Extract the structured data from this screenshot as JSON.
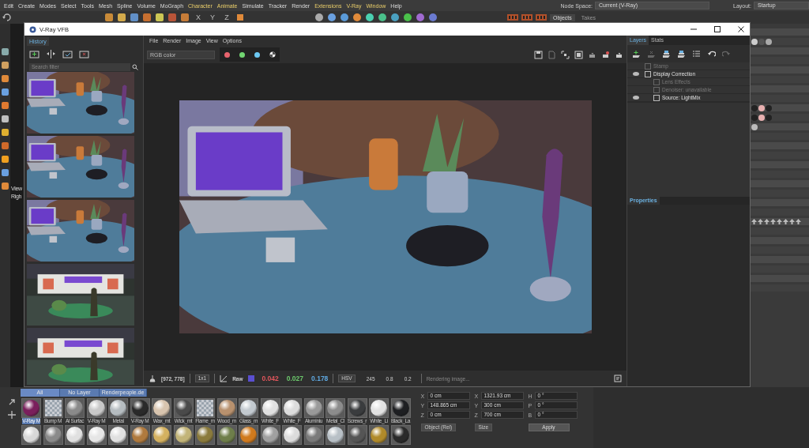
{
  "app_menu": [
    {
      "label": "Edit",
      "highlighted": false
    },
    {
      "label": "Create",
      "highlighted": false
    },
    {
      "label": "Modes",
      "highlighted": false
    },
    {
      "label": "Select",
      "highlighted": false
    },
    {
      "label": "Tools",
      "highlighted": false
    },
    {
      "label": "Mesh",
      "highlighted": false
    },
    {
      "label": "Spline",
      "highlighted": false
    },
    {
      "label": "Volume",
      "highlighted": false
    },
    {
      "label": "MoGraph",
      "highlighted": false
    },
    {
      "label": "Character",
      "highlighted": true
    },
    {
      "label": "Animate",
      "highlighted": true
    },
    {
      "label": "Simulate",
      "highlighted": false
    },
    {
      "label": "Tracker",
      "highlighted": false
    },
    {
      "label": "Render",
      "highlighted": false
    },
    {
      "label": "Extensions",
      "highlighted": true
    },
    {
      "label": "V-Ray",
      "highlighted": true
    },
    {
      "label": "Window",
      "highlighted": true
    },
    {
      "label": "Help",
      "highlighted": false
    }
  ],
  "node_space": {
    "label": "Node Space:",
    "value": "Current (V-Ray)"
  },
  "layout": {
    "label": "Layout:",
    "value": "Startup"
  },
  "toolbar": {
    "axis_buttons": [
      "X",
      "Y",
      "Z"
    ],
    "tabs": [
      {
        "label": "Objects",
        "selected": true
      },
      {
        "label": "Takes",
        "selected": false
      }
    ]
  },
  "viewport_labels": [
    "View",
    "Righ"
  ],
  "vfb": {
    "title": "V-Ray VFB",
    "history": {
      "tab": "History",
      "search": {
        "placeholder": "Search filter"
      }
    },
    "menu": [
      "File",
      "Render",
      "Image",
      "View",
      "Options"
    ],
    "channel_select": {
      "value": "RGB color"
    },
    "channels": [
      {
        "color": "#e8636d"
      },
      {
        "color": "#72d672"
      },
      {
        "color": "#6cc8f2"
      }
    ],
    "layers_panel": {
      "tabs": [
        {
          "label": "Layers",
          "selected": true
        },
        {
          "label": "Stats",
          "selected": false
        }
      ],
      "layers": [
        {
          "name": "Stamp",
          "visible": false,
          "disabled": true
        },
        {
          "name": "Display Correction",
          "visible": true,
          "disabled": false,
          "children": [
            {
              "name": "Lens Effects",
              "visible": false,
              "disabled": true
            },
            {
              "name": "Denoiser: unavailable",
              "visible": false,
              "disabled": true
            },
            {
              "name": "Source: LightMix",
              "visible": true,
              "disabled": false
            }
          ]
        }
      ],
      "properties": "Properties"
    },
    "status": {
      "coords": "[972, 778]",
      "zoom": "1x1",
      "mode": "Raw",
      "values": [
        {
          "text": "0.042",
          "color": "#e0565c"
        },
        {
          "text": "0.027",
          "color": "#6cc86c"
        },
        {
          "text": "0.178",
          "color": "#5fa8e0"
        }
      ],
      "color_space": "HSV",
      "hsv": [
        "245",
        "0.8",
        "0.2"
      ],
      "message": "Rendering image..."
    }
  },
  "materials": {
    "filters": [
      {
        "label": "All",
        "selected": true
      },
      {
        "label": "No Layer",
        "selected": false
      },
      {
        "label": "Renderpeople.de",
        "selected": false
      }
    ],
    "row_1": [
      {
        "label": "V-Ray M",
        "kind": "sphere",
        "color": "#7a1f5c",
        "selected": true
      },
      {
        "label": "Bump M",
        "kind": "checker",
        "color": "#9aa4ae",
        "selected": false
      },
      {
        "label": "Al Surfac",
        "kind": "sphere",
        "color": "#8a8a8a",
        "selected": false
      },
      {
        "label": "V-Ray M",
        "kind": "sphere",
        "color": "#c8c8c8",
        "selected": false
      },
      {
        "label": "Metal",
        "kind": "sphere",
        "color": "#b5bcc0",
        "selected": false
      },
      {
        "label": "V-Ray M",
        "kind": "sphere",
        "color": "#2a2a2a",
        "selected": false
      },
      {
        "label": "Wax_mt",
        "kind": "sphere",
        "color": "#d8c4ae",
        "selected": false
      },
      {
        "label": "Wick_mt",
        "kind": "sphere",
        "color": "#4a4a4a",
        "selected": false
      },
      {
        "label": "Flame_m",
        "kind": "checker",
        "color": "#9aa4ae",
        "selected": false
      },
      {
        "label": "Wood_m",
        "kind": "sphere",
        "color": "#b8916e",
        "selected": false
      },
      {
        "label": "Glass_m",
        "kind": "sphere",
        "color": "#c2c9cf",
        "selected": false
      },
      {
        "label": "White_F",
        "kind": "sphere",
        "color": "#e0e0e0",
        "selected": false
      },
      {
        "label": "White_F",
        "kind": "sphere",
        "color": "#dcdcdc",
        "selected": false
      },
      {
        "label": "Aluminiu",
        "kind": "sphere",
        "color": "#9a9a9a",
        "selected": false
      },
      {
        "label": "Metal_Cl",
        "kind": "sphere",
        "color": "#8c8c8c",
        "selected": false
      },
      {
        "label": "Screws_r",
        "kind": "sphere",
        "color": "#3a3c3e",
        "selected": false
      },
      {
        "label": "White_Li",
        "kind": "sphere",
        "color": "#e2e2e2",
        "selected": false
      },
      {
        "label": "Black_La",
        "kind": "sphere",
        "color": "#1e1f22",
        "selected": false
      }
    ],
    "row_2": [
      {
        "color": "#d8d8d8"
      },
      {
        "color": "#8a8a8a"
      },
      {
        "color": "#e0e0e0"
      },
      {
        "color": "#e6e6e6"
      },
      {
        "color": "#e0e0e0"
      },
      {
        "color": "#b07a3e"
      },
      {
        "color": "#d4b160"
      },
      {
        "color": "#c2b478"
      },
      {
        "color": "#8a7a3c"
      },
      {
        "color": "#6e7e4a"
      },
      {
        "color": "#d07a1e"
      },
      {
        "color": "#a0a0a0"
      },
      {
        "color": "#dcdcdc"
      },
      {
        "color": "#7a7a7a"
      },
      {
        "color": "#b8c0c6"
      },
      {
        "color": "#555555"
      },
      {
        "color": "#b08a2a"
      },
      {
        "color": "#2a2a2a"
      }
    ]
  },
  "coordinates": {
    "rows": [
      {
        "position_axis": "X",
        "position": "0 cm",
        "size_axis": "X",
        "size": "1321.93 cm",
        "rotation_axis": "H",
        "rotation": "0 °"
      },
      {
        "position_axis": "Y",
        "position": "148.865 cm",
        "size_axis": "Y",
        "size": "300 cm",
        "rotation_axis": "P",
        "rotation": "0 °"
      },
      {
        "position_axis": "Z",
        "position": "0 cm",
        "size_axis": "Z",
        "size": "700 cm",
        "rotation_axis": "B",
        "rotation": "0 °"
      }
    ],
    "mode": "Object (Rel)",
    "size_mode": "Size",
    "apply": "Apply"
  }
}
